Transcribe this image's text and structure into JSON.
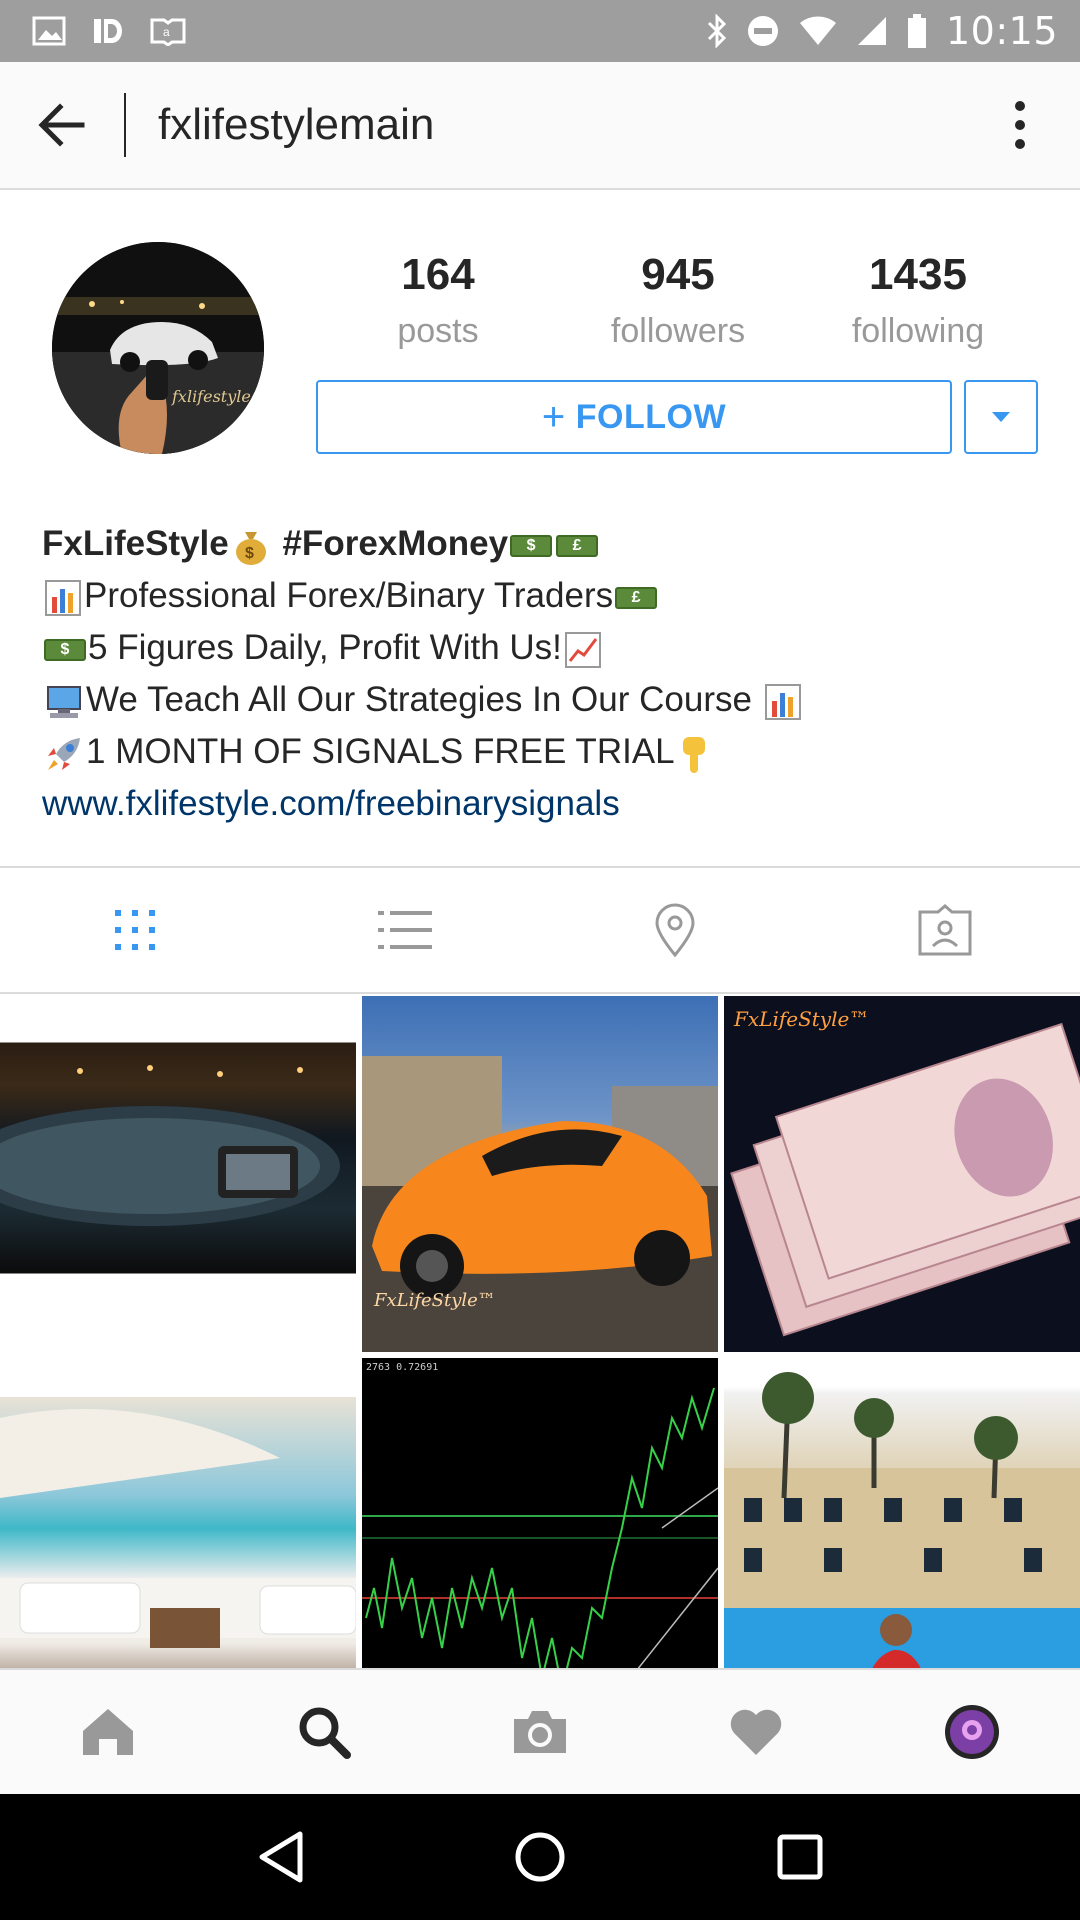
{
  "status_bar": {
    "time": "10:15",
    "left_icons": [
      "image-icon",
      "id-icon",
      "amazon-app-icon"
    ],
    "right_icons": [
      "bluetooth-icon",
      "do-not-disturb-icon",
      "wifi-icon",
      "signal-icon",
      "battery-icon"
    ]
  },
  "header": {
    "username": "fxlifestylemain",
    "back_icon": "back-arrow-icon",
    "more_icon": "more-vertical-icon"
  },
  "profile": {
    "stats": [
      {
        "value": "164",
        "label": "posts"
      },
      {
        "value": "945",
        "label": "followers"
      },
      {
        "value": "1435",
        "label": "following"
      }
    ],
    "follow_label": "FOLLOW",
    "follow_prefix": "+"
  },
  "bio": {
    "name": "FxLifeStyle",
    "hashtag": "#ForexMoney",
    "line1": "Professional Forex/Binary Traders",
    "line2": "5 Figures Daily, Profit With Us!",
    "line3": "We Teach All Our Strategies In Our Course",
    "line4": "1 MONTH OF SIGNALS FREE TRIAL",
    "link": "www.fxlifestyle.com/freebinarysignals",
    "cash_dollar": "$",
    "cash_pound": "£"
  },
  "tabs": [
    "grid-icon",
    "list-icon",
    "location-pin-icon",
    "tagged-photos-icon"
  ],
  "grid": {
    "watermark": "FxLifeStyle™",
    "chart_label": "2763 0.72691"
  },
  "bottom_nav": [
    "home-icon",
    "search-icon",
    "camera-icon",
    "heart-icon",
    "profile-avatar-icon"
  ],
  "colors": {
    "accent": "#3897f0",
    "link": "#003569",
    "text": "#262626",
    "muted": "#999999",
    "status_bar": "#9e9e9e"
  }
}
